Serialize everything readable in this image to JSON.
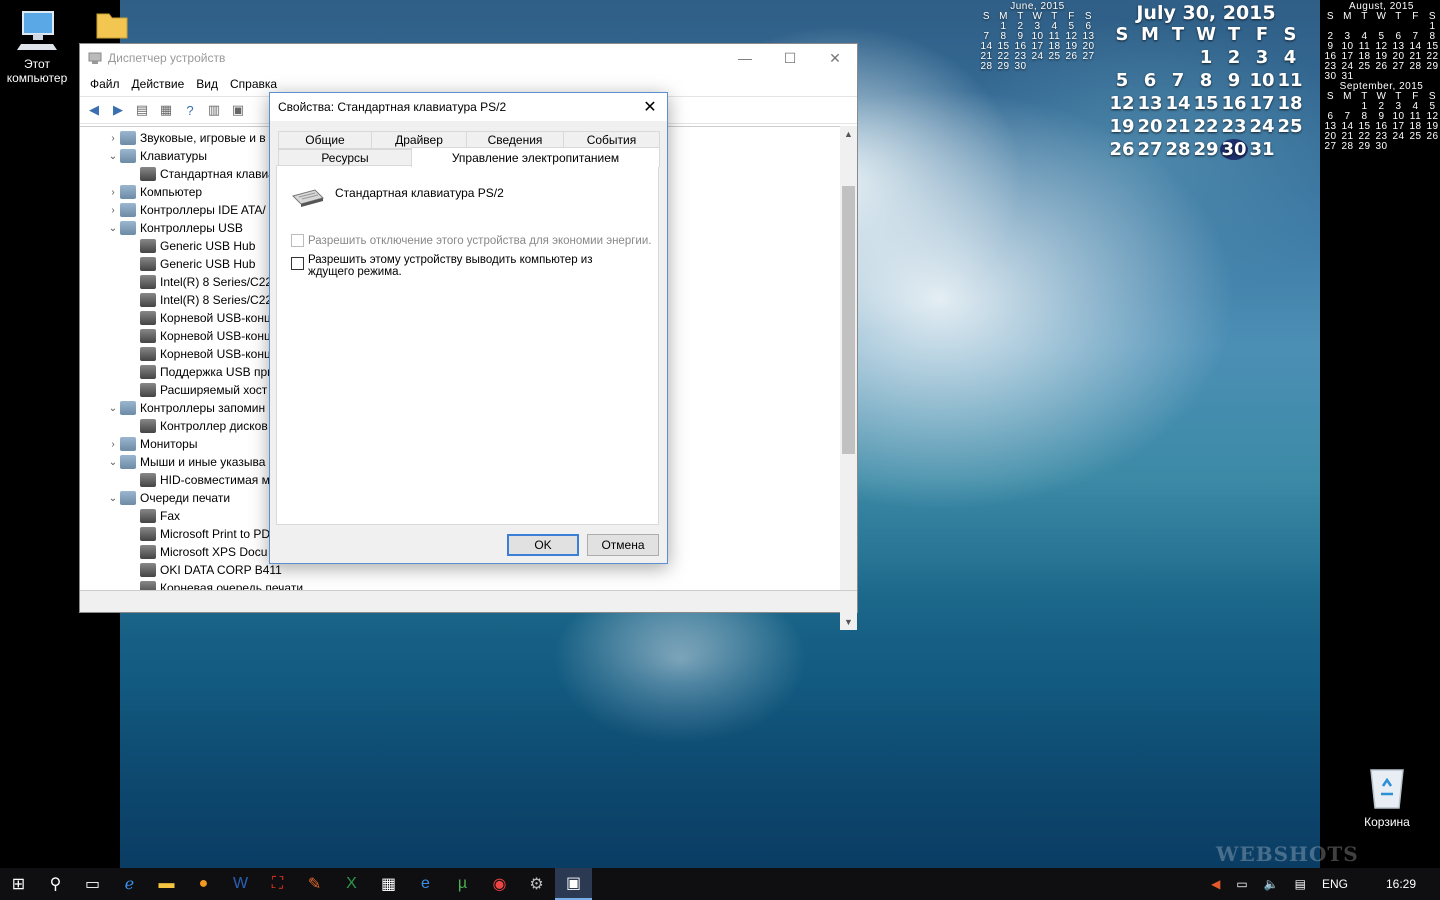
{
  "desktop": {
    "icons": {
      "computer_label": "Этот компьютер",
      "recycle_label": "Корзина"
    },
    "watermark": "WEBSHOTS"
  },
  "calendars": {
    "june": {
      "title": "June, 2015",
      "days_header": [
        "S",
        "M",
        "T",
        "W",
        "T",
        "F",
        "S"
      ],
      "rows": [
        [
          "",
          "1",
          "2",
          "3",
          "4",
          "5",
          "6"
        ],
        [
          "7",
          "8",
          "9",
          "10",
          "11",
          "12",
          "13"
        ],
        [
          "14",
          "15",
          "16",
          "17",
          "18",
          "19",
          "20"
        ],
        [
          "21",
          "22",
          "23",
          "24",
          "25",
          "26",
          "27"
        ],
        [
          "28",
          "29",
          "30",
          "",
          "",
          "",
          ""
        ]
      ]
    },
    "july": {
      "title": "July 30, 2015",
      "days_header": [
        "S",
        "M",
        "T",
        "W",
        "T",
        "F",
        "S"
      ],
      "rows": [
        [
          "",
          "",
          "",
          "1",
          "2",
          "3",
          "4"
        ],
        [
          "5",
          "6",
          "7",
          "8",
          "9",
          "10",
          "11"
        ],
        [
          "12",
          "13",
          "14",
          "15",
          "16",
          "17",
          "18"
        ],
        [
          "19",
          "20",
          "21",
          "22",
          "23",
          "24",
          "25"
        ],
        [
          "26",
          "27",
          "28",
          "29",
          "30",
          "31",
          ""
        ]
      ],
      "today": "30"
    },
    "august": {
      "title": "August, 2015",
      "days_header": [
        "S",
        "M",
        "T",
        "W",
        "T",
        "F",
        "S"
      ],
      "rows": [
        [
          "",
          "",
          "",
          "",
          "",
          "",
          "1"
        ],
        [
          "2",
          "3",
          "4",
          "5",
          "6",
          "7",
          "8"
        ],
        [
          "9",
          "10",
          "11",
          "12",
          "13",
          "14",
          "15"
        ],
        [
          "16",
          "17",
          "18",
          "19",
          "20",
          "21",
          "22"
        ],
        [
          "23",
          "24",
          "25",
          "26",
          "27",
          "28",
          "29"
        ],
        [
          "30",
          "31",
          "",
          "",
          "",
          "",
          ""
        ]
      ]
    },
    "september": {
      "title": "September, 2015",
      "days_header": [
        "S",
        "M",
        "T",
        "W",
        "T",
        "F",
        "S"
      ],
      "rows": [
        [
          "",
          "",
          "1",
          "2",
          "3",
          "4",
          "5"
        ],
        [
          "6",
          "7",
          "8",
          "9",
          "10",
          "11",
          "12"
        ],
        [
          "13",
          "14",
          "15",
          "16",
          "17",
          "18",
          "19"
        ],
        [
          "20",
          "21",
          "22",
          "23",
          "24",
          "25",
          "26"
        ],
        [
          "27",
          "28",
          "29",
          "30",
          "",
          "",
          ""
        ]
      ]
    }
  },
  "device_manager": {
    "title": "Диспетчер устройств",
    "menu": [
      "Файл",
      "Действие",
      "Вид",
      "Справка"
    ],
    "tree": [
      {
        "level": 0,
        "arrow": "›",
        "label": "Звуковые, игровые и в"
      },
      {
        "level": 0,
        "arrow": "⌄",
        "label": "Клавиатуры"
      },
      {
        "level": 1,
        "arrow": "",
        "label": "Стандартная клавиа"
      },
      {
        "level": 0,
        "arrow": "›",
        "label": "Компьютер"
      },
      {
        "level": 0,
        "arrow": "›",
        "label": "Контроллеры IDE ATA/"
      },
      {
        "level": 0,
        "arrow": "⌄",
        "label": "Контроллеры USB"
      },
      {
        "level": 1,
        "arrow": "",
        "label": "Generic USB Hub"
      },
      {
        "level": 1,
        "arrow": "",
        "label": "Generic USB Hub"
      },
      {
        "level": 1,
        "arrow": "",
        "label": "Intel(R) 8 Series/C22"
      },
      {
        "level": 1,
        "arrow": "",
        "label": "Intel(R) 8 Series/C22"
      },
      {
        "level": 1,
        "arrow": "",
        "label": "Корневой USB-конц"
      },
      {
        "level": 1,
        "arrow": "",
        "label": "Корневой USB-конц"
      },
      {
        "level": 1,
        "arrow": "",
        "label": "Корневой USB-конц"
      },
      {
        "level": 1,
        "arrow": "",
        "label": "Поддержка USB при"
      },
      {
        "level": 1,
        "arrow": "",
        "label": "Расширяемый хост"
      },
      {
        "level": 0,
        "arrow": "⌄",
        "label": "Контроллеры запомин"
      },
      {
        "level": 1,
        "arrow": "",
        "label": "Контроллер дисков"
      },
      {
        "level": 0,
        "arrow": "›",
        "label": "Мониторы"
      },
      {
        "level": 0,
        "arrow": "⌄",
        "label": "Мыши и иные указыва"
      },
      {
        "level": 1,
        "arrow": "",
        "label": "HID-совместимая м"
      },
      {
        "level": 0,
        "arrow": "⌄",
        "label": "Очереди печати"
      },
      {
        "level": 1,
        "arrow": "",
        "label": "Fax"
      },
      {
        "level": 1,
        "arrow": "",
        "label": "Microsoft Print to PD"
      },
      {
        "level": 1,
        "arrow": "",
        "label": "Microsoft XPS Docu"
      },
      {
        "level": 1,
        "arrow": "",
        "label": "OKI DATA CORP B411"
      },
      {
        "level": 1,
        "arrow": "",
        "label": "Корневая очередь печати"
      }
    ]
  },
  "properties_dialog": {
    "title": "Свойства: Стандартная клавиатура PS/2",
    "tabs_row1": [
      "Общие",
      "Драйвер",
      "Сведения",
      "События"
    ],
    "tabs_row2": [
      "Ресурсы",
      "Управление электропитанием"
    ],
    "device_name": "Стандартная клавиатура PS/2",
    "option_allow_off": "Разрешить отключение этого устройства для экономии энергии.",
    "option_allow_wake": "Разрешить этому устройству выводить компьютер из ждущего режима.",
    "ok_label": "OK",
    "cancel_label": "Отмена"
  },
  "taskbar": {
    "language": "ENG",
    "time": "16:29"
  }
}
